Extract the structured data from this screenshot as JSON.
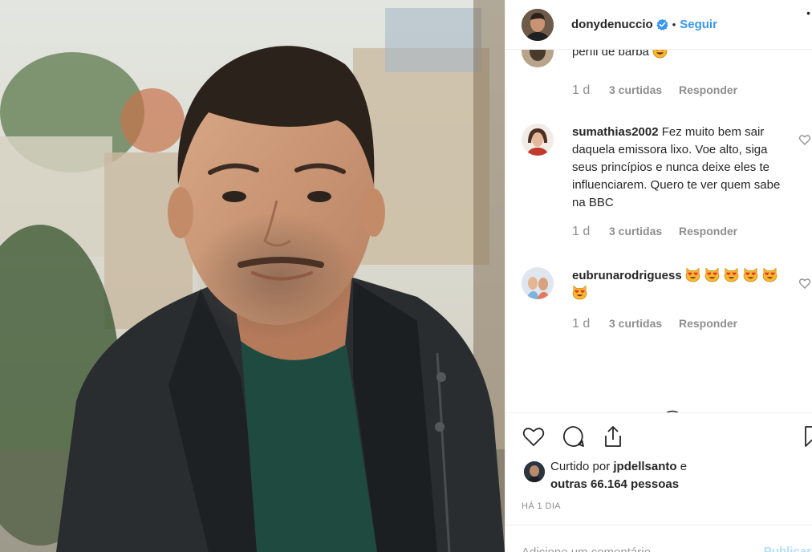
{
  "post": {
    "author": "donydenuccio",
    "verified": true,
    "separator": "•",
    "follow_label": "Seguir",
    "more_icon": "more-options-icon"
  },
  "comments": [
    {
      "username": "",
      "text": "perfil de barba",
      "emojis": [
        "heart-eyes-emoji"
      ],
      "age": "1 d",
      "likes": "3 curtidas",
      "reply_label": "Responder"
    },
    {
      "username": "sumathias2002",
      "text": "Fez muito bem sair daquela emissora lixo. Voe alto, siga seus princípios e nunca deixe eles te influenciarem. Quero te ver quem sabe na BBC",
      "emojis": [],
      "age": "1 d",
      "likes": "3 curtidas",
      "reply_label": "Responder"
    },
    {
      "username": "eubrunarodriguess",
      "text": "",
      "emojis": [
        "heart-eyes-cat-emoji",
        "heart-eyes-cat-emoji",
        "heart-eyes-cat-emoji",
        "heart-eyes-cat-emoji",
        "heart-eyes-cat-emoji",
        "heart-eyes-cat-emoji"
      ],
      "age": "1 d",
      "likes": "3 curtidas",
      "reply_label": "Responder"
    }
  ],
  "actions": {
    "like_icon": "heart-icon",
    "comment_icon": "comment-icon",
    "share_icon": "share-icon",
    "save_icon": "bookmark-icon",
    "load_more_icon": "plus-circle-icon"
  },
  "likes": {
    "prefix": "Curtido por",
    "user": "jpdellsanto",
    "conjunction": "e",
    "others": "outras 66.164 pessoas"
  },
  "timestamp": "HÁ 1 DIA",
  "add_comment": {
    "placeholder": "Adicione um comentário...",
    "publish_label": "Publicar"
  },
  "colors": {
    "link_blue": "#3897f0",
    "verified_blue": "#3897f0",
    "text": "#262626",
    "muted": "#8e8e8e",
    "publish_disabled": "#b2dffc"
  }
}
